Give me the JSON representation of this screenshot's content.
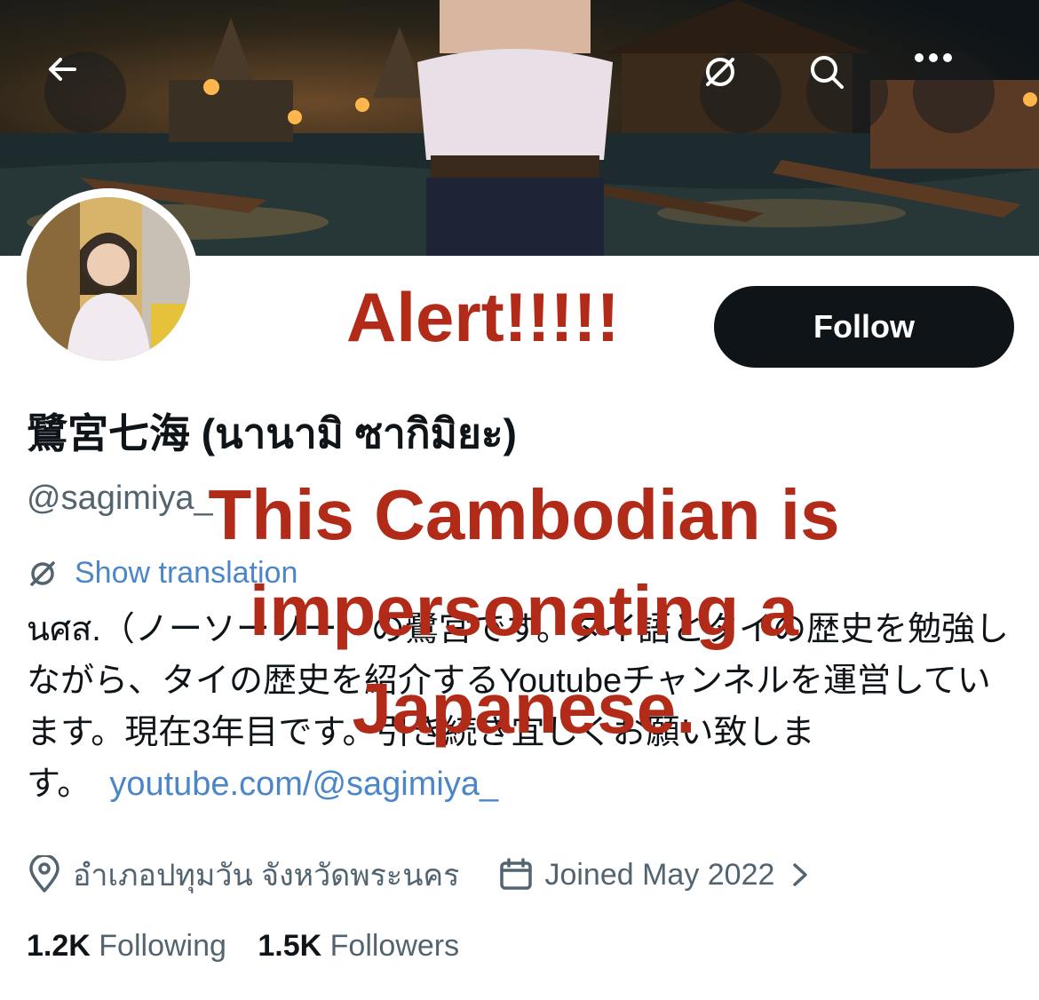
{
  "profile": {
    "display_name": "鷺宮七海 (นานามิ ซากิมิยะ)",
    "handle": "@sagimiya_",
    "follow_label": "Follow",
    "translate_label": "Show translation",
    "bio_text": "นศส.（ノーソーソー）の鷺宮です。タイ語とタイの歴史を勉強しながら、タイの歴史を紹介するYoutubeチャンネルを運営しています。現在3年目です。引き続き宜しくお願い致します。",
    "bio_link": "youtube.com/@sagimiya_",
    "location": "อำเภอปทุมวัน จังหวัดพระนคร",
    "joined": "Joined May 2022",
    "following_count": "1.2K",
    "following_label": "Following",
    "followers_count": "1.5K",
    "followers_label": "Followers"
  },
  "nav": {
    "back_icon": "arrow-left-icon",
    "translate_icon": "translate-icon",
    "search_icon": "search-icon",
    "more_icon": "more-icon"
  },
  "overlay": {
    "alert": "Alert!!!!!",
    "line1": "This Cambodian is",
    "line2": "impersonating a",
    "line3": "Japanese."
  },
  "colors": {
    "overlay_red": "#b22a18",
    "link_blue": "#4a86c8",
    "text_dark": "#0f1419",
    "text_gray": "#536471"
  }
}
